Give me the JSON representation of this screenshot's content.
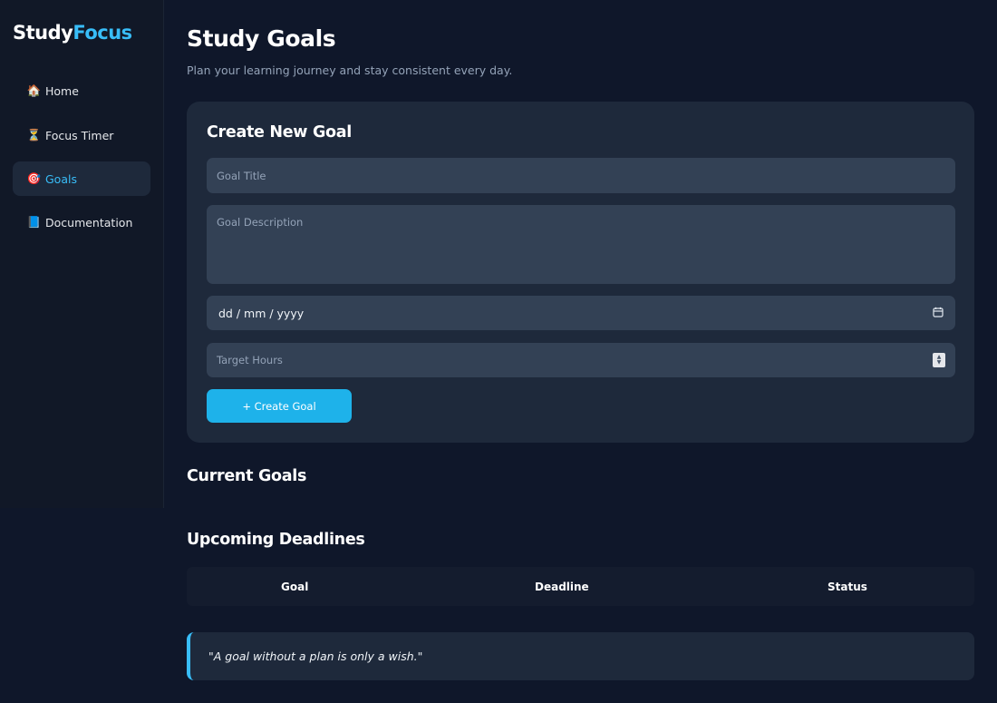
{
  "app": {
    "logo_primary": "Study",
    "logo_accent": "Focus",
    "accent_color": "#38bdf8"
  },
  "sidebar": {
    "items": [
      {
        "label": "Home",
        "icon": "house-icon",
        "glyph": "🏠",
        "active": false
      },
      {
        "label": "Focus Timer",
        "icon": "hourglass-icon",
        "glyph": "⏳",
        "active": false
      },
      {
        "label": "Goals",
        "icon": "target-icon",
        "glyph": "🎯",
        "active": true
      },
      {
        "label": "Documentation",
        "icon": "book-icon",
        "glyph": "📘",
        "active": false
      }
    ]
  },
  "main": {
    "title": "Study Goals",
    "subtitle": "Plan your learning journey and stay consistent every day."
  },
  "form": {
    "heading": "Create New Goal",
    "title_placeholder": "Goal Title",
    "description_placeholder": "Goal Description",
    "date_value": "dd / mm / yyyy",
    "hours_placeholder": "Target Hours",
    "submit_label": "+ Create Goal",
    "submit_color": "#1eb2ea"
  },
  "current_goals": {
    "heading": "Current Goals"
  },
  "deadlines": {
    "heading": "Upcoming Deadlines",
    "columns": [
      "Goal",
      "Deadline",
      "Status"
    ]
  },
  "quote": {
    "text": "\"A goal without a plan is only a wish.\""
  }
}
